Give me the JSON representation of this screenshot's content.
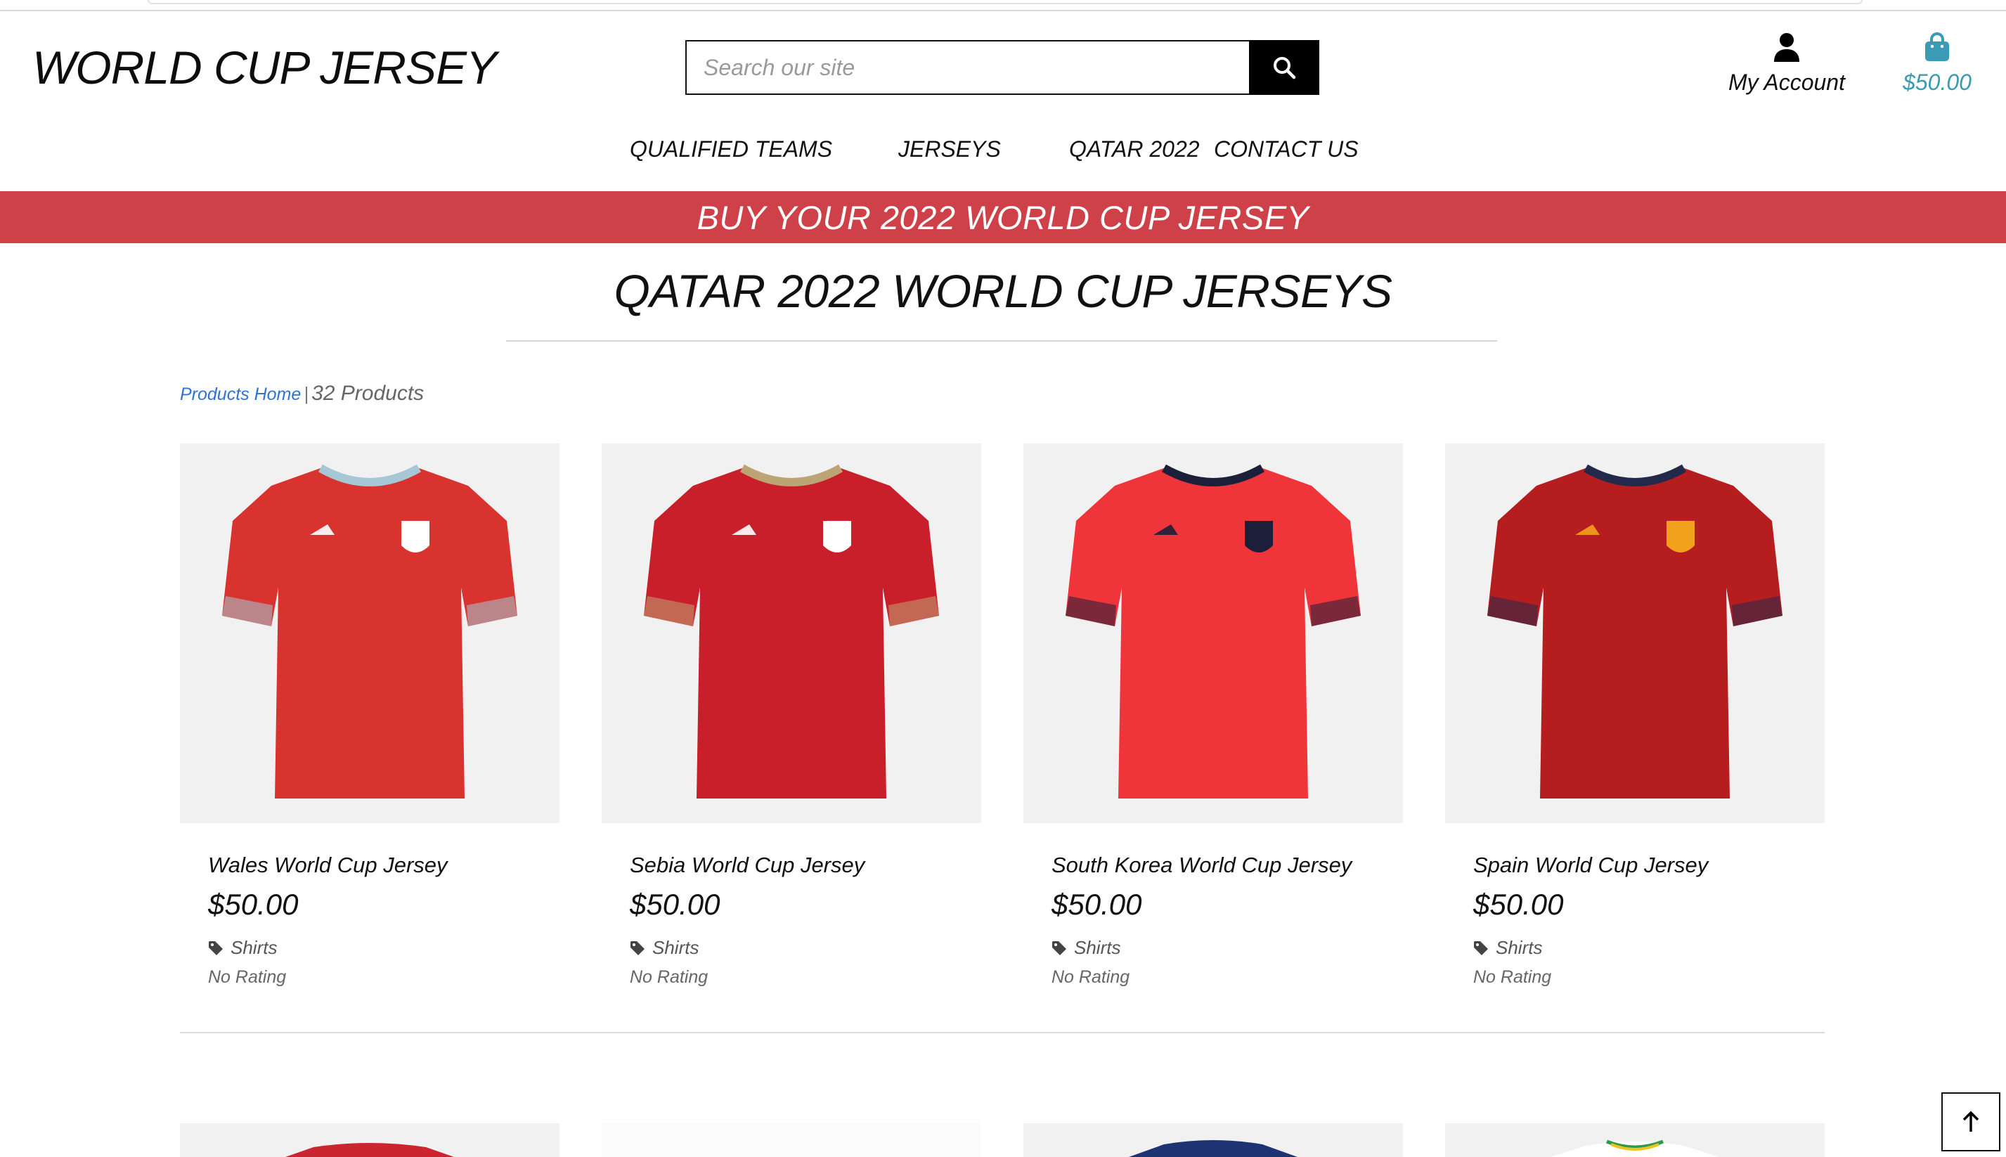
{
  "header": {
    "logo": "WORLD CUP JERSEY",
    "search_placeholder": "Search our site",
    "account_label": "My Account",
    "cart_total": "$50.00"
  },
  "nav": {
    "items": [
      {
        "label": "QUALIFIED TEAMS"
      },
      {
        "label": "JERSEYS"
      },
      {
        "label": "QATAR 2022"
      },
      {
        "label": "CONTACT US"
      }
    ]
  },
  "banner": {
    "text": "BUY YOUR 2022 WORLD CUP JERSEY"
  },
  "page": {
    "title": "QATAR 2022 WORLD CUP JERSEYS",
    "breadcrumb_link": "Products Home",
    "separator": "|",
    "product_count": "32 Products"
  },
  "products": [
    {
      "name": "Wales World Cup Jersey",
      "price": "$50.00",
      "category": "Shirts",
      "rating": "No Rating",
      "color": "#d8332f",
      "collar": "#a6c8d6",
      "crest": "#ffffff"
    },
    {
      "name": "Sebia World Cup Jersey",
      "price": "$50.00",
      "category": "Shirts",
      "rating": "No Rating",
      "color": "#c91f2b",
      "collar": "#bda475",
      "crest": "#ffffff"
    },
    {
      "name": "South Korea World Cup Jersey",
      "price": "$50.00",
      "category": "Shirts",
      "rating": "No Rating",
      "color": "#f0353a",
      "collar": "#1c1f3a",
      "crest": "#1c1f3a"
    },
    {
      "name": "Spain World Cup Jersey",
      "price": "$50.00",
      "category": "Shirts",
      "rating": "No Rating",
      "color": "#b51d1f",
      "collar": "#23294a",
      "crest": "#f2a21c"
    }
  ],
  "colors": {
    "banner": "#cf4148",
    "accent_link": "#2e74d4",
    "cart": "#3a9bb4"
  },
  "icons": {
    "search": "search-icon",
    "account": "user-icon",
    "cart": "shopping-bag-icon",
    "category": "tag-icon",
    "back_to_top": "arrow-up-icon"
  }
}
